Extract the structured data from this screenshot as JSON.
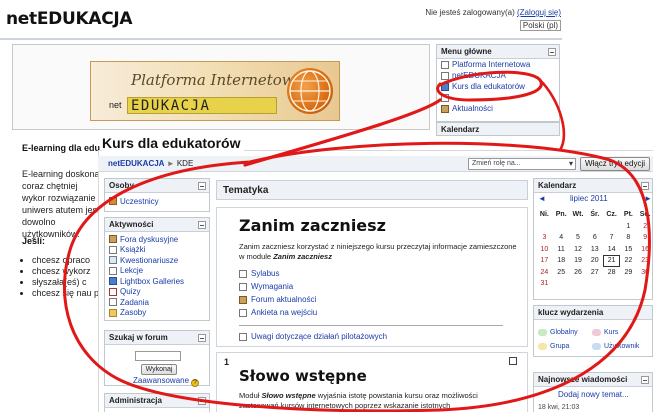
{
  "site": {
    "title": "netEDUKACJA",
    "login_text": "Nie jesteś zalogowany(a)",
    "login_link": "(Zaloguj się)",
    "language": "Polski (pl)"
  },
  "banner": {
    "script_text": "Platforma Internetowa",
    "prefix": "net",
    "brand": "EDUKACJA"
  },
  "back_left": {
    "title": "E-learning dla edu",
    "paragraph": "E-learning doskonal coraz chętniej wykor rozwiązanie uniwers atutem jest dowolno użytkowników.",
    "jesli": "Jeśli:",
    "bullets": [
      "chcesz opraco",
      "chcesz wykorz",
      "słyszała(eś) c",
      "chcesz się nau pomocą tego"
    ]
  },
  "menu_glowne": {
    "title": "Menu główne",
    "items": [
      {
        "label": "Platforma Internetowa",
        "icon": "document-icon"
      },
      {
        "label": "netEDUKACJA",
        "icon": "document-icon"
      },
      {
        "label": "Kurs dla edukatorów",
        "icon": "course-icon"
      },
      {
        "label": "",
        "icon": "document-icon"
      },
      {
        "label": "Aktualności",
        "icon": "forum-icon"
      }
    ]
  },
  "kalendarz_back": {
    "title": "Kalendarz"
  },
  "course": {
    "title": "Kurs dla edukatorów",
    "breadcrumb_root": "netEDUKACJA",
    "breadcrumb_sep": "►",
    "breadcrumb_current": "KDE",
    "role_placeholder": "Zmień rolę na...",
    "edit_button": "Włącz tryb edycji"
  },
  "osoby": {
    "title": "Osoby",
    "items": [
      {
        "label": "Uczestnicy",
        "icon": "users-icon"
      }
    ]
  },
  "aktywnosci": {
    "title": "Aktywności",
    "items": [
      {
        "label": "Fora dyskusyjne",
        "icon": "forum-icon"
      },
      {
        "label": "Książki",
        "icon": "book-icon"
      },
      {
        "label": "Kwestionariusze",
        "icon": "questionnaire-icon"
      },
      {
        "label": "Lekcje",
        "icon": "lesson-icon"
      },
      {
        "label": "Lightbox Galleries",
        "icon": "gallery-icon"
      },
      {
        "label": "Quizy",
        "icon": "quiz-icon"
      },
      {
        "label": "Zadania",
        "icon": "assignment-icon"
      },
      {
        "label": "Zasoby",
        "icon": "resource-icon"
      }
    ]
  },
  "szukaj": {
    "title": "Szukaj w forum",
    "button": "Wykonaj",
    "advanced": "Zaawansowane"
  },
  "admin": {
    "title": "Administracja"
  },
  "tematyka": {
    "header": "Tematyka",
    "topic0": {
      "title": "Zanim zaczniesz",
      "desc_pre": "Zanim zaczniesz korzystać z niniejszego kursu przeczytaj informacje zamieszczone w module ",
      "desc_em": "Zanim zaczniesz",
      "items": [
        {
          "label": "Sylabus",
          "icon": "document-icon"
        },
        {
          "label": "Wymagania",
          "icon": "document-icon"
        },
        {
          "label": "Forum aktualności",
          "icon": "forum-icon"
        },
        {
          "label": "Ankieta na wejściu",
          "icon": "document-icon"
        }
      ],
      "uwagi": "Uwagi dotyczące działań pilotażowych"
    },
    "topic1": {
      "number": "1",
      "title": "Słowo wstępne",
      "desc_pre": "Moduł ",
      "desc_em": "Słowo wstępne",
      "desc_post": " wyjaśnia istotę powstania kursu oraz możliwości zastosowań kursów internetowych poprzez wskazanie istotnych"
    }
  },
  "kalendarz": {
    "title": "Kalendarz",
    "prev": "◄",
    "month": "lipiec 2011",
    "next": "►",
    "day_headers": [
      "Ni.",
      "Pn.",
      "Wt.",
      "Śr.",
      "Cz.",
      "Pt.",
      "So."
    ],
    "weeks": [
      [
        "",
        "",
        "",
        "",
        "",
        "1",
        "2"
      ],
      [
        "3",
        "4",
        "5",
        "6",
        "7",
        "8",
        "9"
      ],
      [
        "10",
        "11",
        "12",
        "13",
        "14",
        "15",
        "16"
      ],
      [
        "17",
        "18",
        "19",
        "20",
        "21",
        "22",
        "23"
      ],
      [
        "24",
        "25",
        "26",
        "27",
        "28",
        "29",
        "30"
      ],
      [
        "31",
        "",
        "",
        "",
        "",
        "",
        ""
      ]
    ],
    "today": "21"
  },
  "klucz": {
    "title": "klucz wydarzenia",
    "items": [
      {
        "label": "Globalny",
        "color": "#c9e8c4"
      },
      {
        "label": "Kurs",
        "color": "#f2c8d8"
      },
      {
        "label": "Grupa",
        "color": "#f6e6a8"
      },
      {
        "label": "Użytkownik",
        "color": "#c8dcf2"
      }
    ]
  },
  "news": {
    "title": "Najnowsze wiadomości",
    "add": "Dodaj nowy temat...",
    "date": "18 kwi, 21:03"
  },
  "colors": {
    "link": "#1a3da8",
    "annotation": "#e01818",
    "header_bg": "#eef1f5"
  }
}
